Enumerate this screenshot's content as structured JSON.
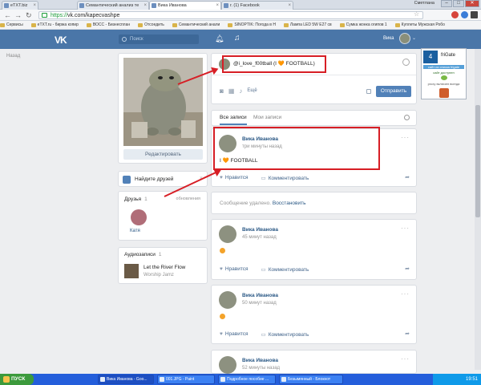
{
  "browser": {
    "tabs": [
      {
        "label": "eTXT.biz",
        "active": false
      },
      {
        "label": "Семантический анализ те",
        "active": false
      },
      {
        "label": "Вика Иванова",
        "active": true
      },
      {
        "label": "г. (1) Facebook",
        "active": false
      }
    ],
    "user": "Сметлана",
    "window_controls": {
      "minimize": "–",
      "maximize": "□",
      "close": "✕"
    },
    "url_scheme": "https://",
    "url_rest": "vk.com/kapecvashpe",
    "bookmarks": [
      "Сервисы",
      "eTXT.ru - биржа копир",
      "ВОСС - Бизнесплан",
      "Отсоедить",
      "Семантический анали",
      "SINOPTIK: Погода в Н",
      "Лампа LED 5W E27 св",
      "Сумка жонка огипов 1",
      "Куплеты Мужская Робо"
    ]
  },
  "vk_header": {
    "logo": "VK",
    "search_placeholder": "Поиск",
    "user_name": "Вика"
  },
  "sidebar": {
    "back_label": "Назад"
  },
  "profile": {
    "edit_button": "Редактировать"
  },
  "friends_find": {
    "label": "Найдите друзей"
  },
  "friends": {
    "title": "Друзья",
    "count": "1",
    "updates": "обновления",
    "items": [
      {
        "name": "Катя"
      }
    ]
  },
  "audio": {
    "title": "Аудиозаписи",
    "count": "1",
    "tracks": [
      {
        "title": "Let the River Flow",
        "artist": "Worship Jamz"
      }
    ]
  },
  "composer": {
    "text": "@i_love_f00tball (I 🧡 FOOTBALL)",
    "more_label": "Ещё",
    "send_button": "Отправить"
  },
  "wall_tabs": {
    "all": "Все записи",
    "mine": "Мои записи"
  },
  "posts": [
    {
      "name": "Вика Иванова",
      "time": "три минуты назад",
      "body": "I 🧡 FOOTBALL",
      "like": "Нравится",
      "comment": "Комментировать"
    },
    {
      "name": "Вика Иванова",
      "time": "45 минут назад",
      "like": "Нравится",
      "comment": "Комментировать"
    },
    {
      "name": "Вика Иванова",
      "time": "50 минут назад",
      "like": "Нравится",
      "comment": "Комментировать"
    },
    {
      "name": "Вика Иванова",
      "time": "52 минуты назад"
    }
  ],
  "deleted": {
    "text": "Сообщение удалено.",
    "restore": "Восстановить"
  },
  "frigate": {
    "title": "friGate",
    "banner": "сайт из списка frigate",
    "line1": "сайт доступен",
    "line2": "proxy включен всегда"
  },
  "taskbar": {
    "start": "ПУСК",
    "items": [
      "Вика Иванова - Goo...",
      "001.JPG - Paint",
      "Подробное пособие ...",
      "Безымянный - Блокнот"
    ],
    "clock": "19:51"
  },
  "colors": {
    "vk_blue": "#4a76a8",
    "button_blue": "#5181b8",
    "highlight_red": "#d71e25",
    "taskbar": "#245edb"
  }
}
